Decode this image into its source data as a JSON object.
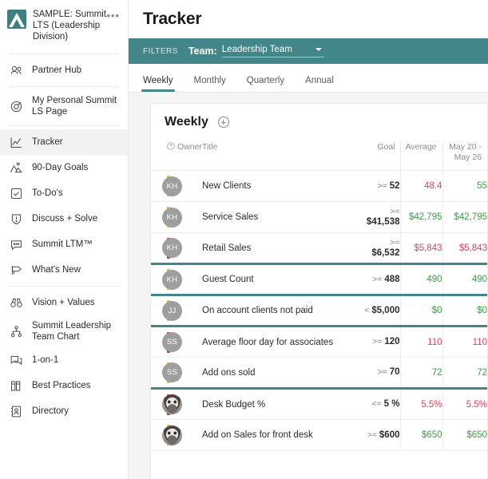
{
  "sidebar": {
    "org": {
      "name": "SAMPLE: Summit LTS (Leadership Division)",
      "menu_label": "•••"
    },
    "items": [
      {
        "label": "Partner Hub",
        "icon": "people-icon",
        "active": false
      },
      {
        "label": "My Personal Summit LS Page",
        "icon": "target-icon",
        "active": false
      },
      {
        "label": "Tracker",
        "icon": "chart-line-icon",
        "active": true
      },
      {
        "label": "90-Day Goals",
        "icon": "mountain-flag-icon",
        "active": false
      },
      {
        "label": "To-Do's",
        "icon": "checkbox-icon",
        "active": false
      },
      {
        "label": "Discuss + Solve",
        "icon": "shield-alert-icon",
        "active": false
      },
      {
        "label": "Summit LTM™",
        "icon": "speech-bubble-icon",
        "active": false
      },
      {
        "label": "What's New",
        "icon": "megaphone-icon",
        "active": false
      },
      {
        "label": "Vision + Values",
        "icon": "binoculars-icon",
        "active": false
      },
      {
        "label": "Summit Leadership Team Chart",
        "icon": "org-chart-icon",
        "active": false
      },
      {
        "label": "1-on-1",
        "icon": "chat-icon",
        "active": false
      },
      {
        "label": "Best Practices",
        "icon": "books-icon",
        "active": false
      },
      {
        "label": "Directory",
        "icon": "contact-card-icon",
        "active": false
      }
    ]
  },
  "header": {
    "title": "Tracker"
  },
  "filters": {
    "label": "FILTERS",
    "team_label": "Team:",
    "team_value": "Leadership Team"
  },
  "tabs": [
    {
      "label": "Weekly",
      "active": true
    },
    {
      "label": "Monthly",
      "active": false
    },
    {
      "label": "Quarterly",
      "active": false
    },
    {
      "label": "Annual",
      "active": false
    }
  ],
  "card": {
    "title": "Weekly",
    "add_label": "+"
  },
  "table": {
    "columns": {
      "owner": "Owner",
      "title": "Title",
      "goal": "Goal",
      "average": "Average",
      "week": "May 20 - May 26"
    },
    "rows": [
      {
        "flag": "#f0b429",
        "avatar": "KH",
        "avatar_type": "initials",
        "title": "New Clients",
        "goal_op": ">=",
        "goal_value": "52",
        "goal_wrap": false,
        "average": "48.4",
        "average_state": "neg",
        "week": "55",
        "week_state": "pos",
        "group_end": false
      },
      {
        "flag": "#f0b429",
        "avatar": "KH",
        "avatar_type": "initials",
        "title": "Service Sales",
        "goal_op": ">=",
        "goal_value": "$41,538",
        "goal_wrap": true,
        "average": "$42,795",
        "average_state": "pos",
        "week": "$42,795",
        "week_state": "pos",
        "group_end": false
      },
      {
        "flag": "#d6274a",
        "avatar": "KH",
        "avatar_type": "initials",
        "title": "Retail Sales",
        "goal_op": ">=",
        "goal_value": "$6,532",
        "goal_wrap": true,
        "average": "$5,843",
        "average_state": "neg",
        "week": "$5,843",
        "week_state": "neg",
        "group_end": true
      },
      {
        "flag": "#f0b429",
        "avatar": "KH",
        "avatar_type": "initials",
        "title": "Guest Count",
        "goal_op": ">=",
        "goal_value": "488",
        "goal_wrap": false,
        "average": "490",
        "average_state": "pos",
        "week": "490",
        "week_state": "pos",
        "group_end": true
      },
      {
        "flag": "#f0b429",
        "avatar": "JJ",
        "avatar_type": "initials",
        "title": "On account clients not paid",
        "goal_op": "<",
        "goal_value": "$5,000",
        "goal_wrap": false,
        "average": "$0",
        "average_state": "pos",
        "week": "$0",
        "week_state": "pos",
        "group_end": true
      },
      {
        "flag": "#d6274a",
        "avatar": "SS",
        "avatar_type": "initials",
        "title": "Average floor day for associates",
        "goal_op": ">=",
        "goal_value": "120",
        "goal_wrap": false,
        "average": "110",
        "average_state": "neg",
        "week": "110",
        "week_state": "neg",
        "group_end": false
      },
      {
        "flag": "#f0b429",
        "avatar": "SS",
        "avatar_type": "initials",
        "title": "Add ons sold",
        "goal_op": ">=",
        "goal_value": "70",
        "goal_wrap": false,
        "average": "72",
        "average_state": "pos",
        "week": "72",
        "week_state": "pos",
        "group_end": true
      },
      {
        "flag": "#d6274a",
        "avatar": "",
        "avatar_type": "photo",
        "title": "Desk Budget %",
        "goal_op": "<=",
        "goal_value": "5 %",
        "goal_wrap": false,
        "average": "5.5%",
        "average_state": "neg",
        "week": "5.5%",
        "week_state": "neg",
        "group_end": false
      },
      {
        "flag": "#f0b429",
        "avatar": "",
        "avatar_type": "photo",
        "title": "Add on Sales for front desk",
        "goal_op": ">=",
        "goal_value": "$600",
        "goal_wrap": false,
        "average": "$650",
        "average_state": "pos",
        "week": "$650",
        "week_state": "pos",
        "group_end": false
      }
    ]
  },
  "colors": {
    "accent_teal": "#43868a",
    "positive_green": "#3f9c4a",
    "negative_red": "#d6455c",
    "flag_yellow": "#f0b429",
    "flag_red": "#d6274a"
  }
}
